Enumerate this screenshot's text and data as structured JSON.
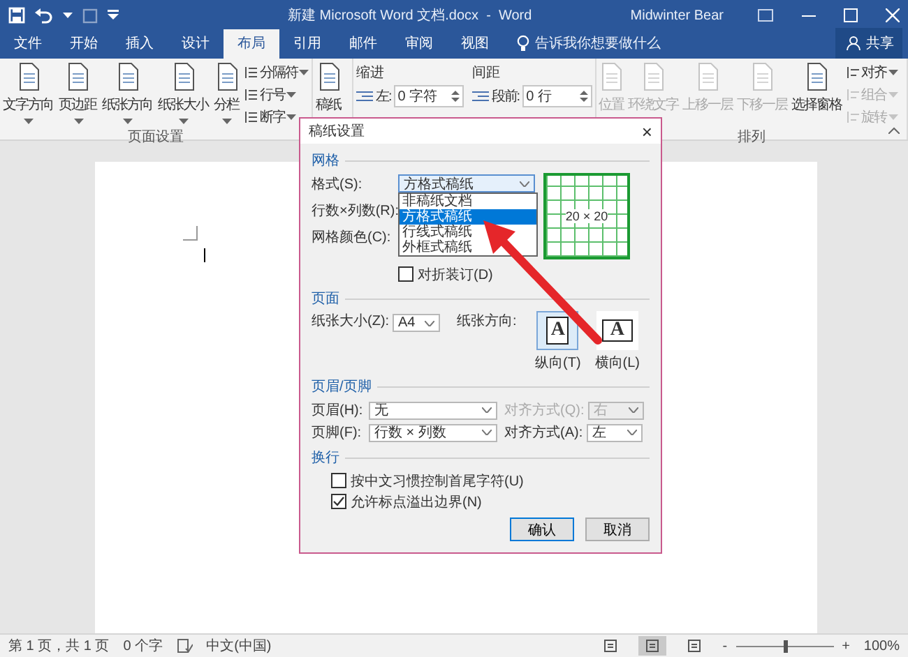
{
  "title_bar": {
    "title": "新建 Microsoft Word 文档.docx  -  Word",
    "user": "Midwinter Bear"
  },
  "tabs": [
    {
      "label": "文件",
      "selected": false
    },
    {
      "label": "开始",
      "selected": false
    },
    {
      "label": "插入",
      "selected": false
    },
    {
      "label": "设计",
      "selected": false
    },
    {
      "label": "布局",
      "selected": true
    },
    {
      "label": "引用",
      "selected": false
    },
    {
      "label": "邮件",
      "selected": false
    },
    {
      "label": "审阅",
      "selected": false
    },
    {
      "label": "视图",
      "selected": false
    }
  ],
  "tell_me": "告诉我你想要做什么",
  "share": "共享",
  "ribbon": {
    "page_setup": {
      "label": "页面设置",
      "large": [
        {
          "label": "文字方向",
          "dropdown": true
        },
        {
          "label": "页边距",
          "dropdown": true
        },
        {
          "label": "纸张方向",
          "dropdown": true
        },
        {
          "label": "纸张大小",
          "dropdown": true
        },
        {
          "label": "分栏",
          "dropdown": true
        }
      ],
      "small": [
        {
          "label": "分隔符"
        },
        {
          "label": "行号"
        },
        {
          "label": "断字"
        }
      ]
    },
    "manuscript": {
      "button": "稿纸"
    },
    "paragraph": {
      "indent": {
        "heading": "缩进",
        "label": "左:",
        "value": "0 字符"
      },
      "spacing": {
        "heading": "间距",
        "label": "段前:",
        "value": "0 行"
      }
    },
    "arrange": {
      "label": "排列",
      "large": [
        {
          "label": "位置",
          "disabled": true
        },
        {
          "label": "环绕文字",
          "disabled": true
        },
        {
          "label": "上移一层",
          "disabled": true
        },
        {
          "label": "下移一层",
          "disabled": true
        },
        {
          "label": "选择窗格",
          "disabled": false
        }
      ],
      "small": [
        {
          "label": "对齐",
          "disabled": false
        },
        {
          "label": "组合",
          "disabled": true
        },
        {
          "label": "旋转",
          "disabled": true
        }
      ]
    }
  },
  "dialog": {
    "title": "稿纸设置",
    "close": "×",
    "grid": {
      "heading": "网格",
      "style_label": "格式(S):",
      "style_value": "方格式稿纸",
      "style_options": [
        {
          "label": "非稿纸文档",
          "selected": false
        },
        {
          "label": "方格式稿纸",
          "selected": true
        },
        {
          "label": "行线式稿纸",
          "selected": false
        },
        {
          "label": "外框式稿纸",
          "selected": false
        }
      ],
      "size_label": "行数×列数(R):",
      "color_label": "网格颜色(C):",
      "fold": {
        "label": "对折装订(D)",
        "checked": false
      },
      "preview_text": "20 × 20"
    },
    "page": {
      "heading": "页面",
      "size_label": "纸张大小(Z):",
      "size_value": "A4",
      "orientation_label": "纸张方向:",
      "orientations": [
        {
          "glyph": "A",
          "label": "纵向(T)",
          "selected": true
        },
        {
          "glyph": "A",
          "label": "横向(L)",
          "selected": false
        }
      ]
    },
    "header_footer": {
      "heading": "页眉/页脚",
      "rows": [
        {
          "label": "页眉(H):",
          "value": "无",
          "align_label": "对齐方式(Q):",
          "align_value": "右",
          "disabled": true
        },
        {
          "label": "页脚(F):",
          "value": "行数 × 列数",
          "align_label": "对齐方式(A):",
          "align_value": "左",
          "disabled": false
        }
      ]
    },
    "wrap": {
      "heading": "换行",
      "options": [
        {
          "label": "按中文习惯控制首尾字符(U)",
          "checked": false
        },
        {
          "label": "允许标点溢出边界(N)",
          "checked": true
        }
      ]
    },
    "buttons": [
      {
        "label": "确认",
        "default": true
      },
      {
        "label": "取消",
        "default": false
      }
    ]
  },
  "status_bar": {
    "page": "第 1 页，共 1 页",
    "words": "0 个字",
    "language": "中文(中国)",
    "views": [
      {
        "selected": false
      },
      {
        "selected": true
      },
      {
        "selected": false
      }
    ],
    "zoom_out": "-",
    "zoom_in": "+",
    "zoom": {
      "level": 0.5
    },
    "zoom_reading": "100%"
  }
}
